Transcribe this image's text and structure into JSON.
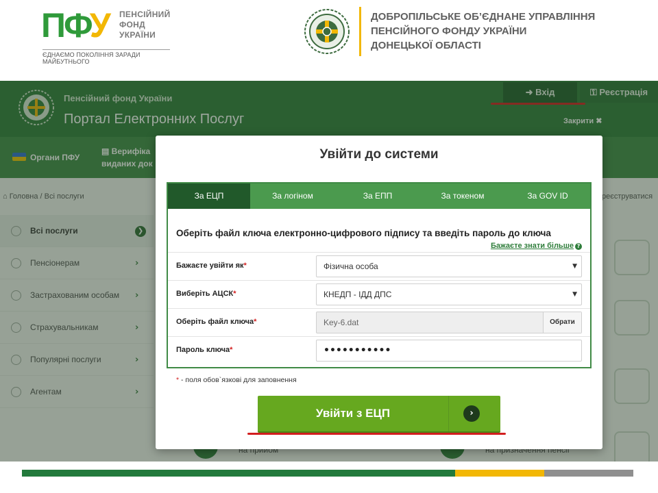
{
  "slide_header": {
    "logo_mark": "ПФУ",
    "logo_name_lines": [
      "ПЕНСІЙНИЙ",
      "ФОНД",
      "УКРАЇНИ"
    ],
    "logo_tagline": "ЄДНАЄМО ПОКОЛІННЯ ЗАРАДИ МАЙБУТНЬОГО",
    "department_lines": [
      "ДОБРОПІЛЬСЬКЕ ОБ’ЄДНАНЕ УПРАВЛІННЯ",
      "ПЕНСІЙНОГО ФОНДУ УКРАЇНИ",
      "ДОНЕЦЬКОЇ ОБЛАСТІ"
    ]
  },
  "portal": {
    "fund_name": "Пенсійний фонд України",
    "portal_name": "Портал Електронних Послуг",
    "login_label": "Вхід",
    "login_icon": "sign-in-icon",
    "register_label": "Реєстрація",
    "register_icon": "key-icon",
    "close_label": "Закрити"
  },
  "nav": {
    "organs": "Органи ПФУ",
    "verif_line1": "Верифіка",
    "verif_line2": "виданих док"
  },
  "breadcrumb": {
    "home": "Головна",
    "current": "Всі послуги",
    "right_text": "реєструватися"
  },
  "sidebar": {
    "items": [
      {
        "label": "Всі послуги",
        "active": true
      },
      {
        "label": "Пенсіонерам",
        "active": false
      },
      {
        "label": "Застрахованим особам",
        "active": false
      },
      {
        "label": "Страхувальникам",
        "active": false
      },
      {
        "label": "Популярні послуги",
        "active": false
      },
      {
        "label": "Агентам",
        "active": false
      }
    ]
  },
  "background": {
    "bottom_text_1": "на прийом",
    "bottom_text_2": "на призначення пенсії"
  },
  "modal": {
    "title": "Увійти до системи",
    "tabs": [
      "За ЕЦП",
      "За логіном",
      "За ЕПП",
      "За токеном",
      "За GOV ID"
    ],
    "active_tab": "За ЕЦП",
    "heading": "Оберіть файл ключа електронно-цифрового підпису та введіть пароль до ключа",
    "learn_more": "Бажаєте знати більше",
    "fields": {
      "login_as_label": "Бажаєте увійти як",
      "login_as_value": "Фізична особа",
      "acsk_label": "Виберіть АЦСК",
      "acsk_value": "КНЕДП - ІДД ДПС",
      "key_file_label": "Оберіть файл ключа",
      "key_file_value": "Key-6.dat",
      "browse_label": "Обрати",
      "password_label": "Пароль ключа",
      "password_value": "•••••••••••"
    },
    "required_mark": "*",
    "required_note": " - поля обов`язкові для заповнення",
    "submit_label": "Увійти з ЕЦП"
  },
  "colors": {
    "portal_green": "#2e7d3a",
    "tab_active": "#21592a",
    "submit_green": "#66a81f",
    "highlight_red": "#d21e1e",
    "stripe_green": "#237a3c",
    "stripe_yellow": "#f2b705",
    "stripe_gray": "#8f8f8f"
  }
}
